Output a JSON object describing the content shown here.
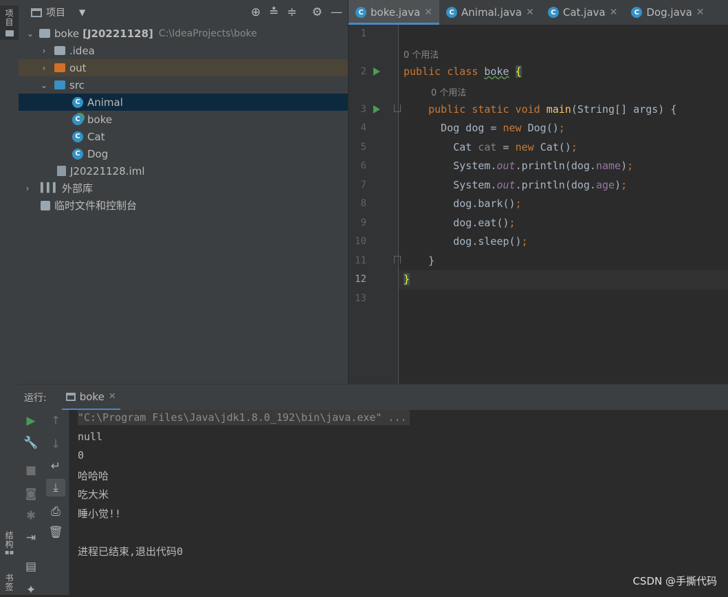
{
  "left_strip": {
    "project_tab": "项目",
    "structure_tab": "结构",
    "bookmarks_tab": "书签"
  },
  "project": {
    "title": "项目",
    "tree": [
      {
        "label": "boke",
        "bold_suffix": "[J20221128]",
        "hint": "C:\\IdeaProjects\\boke",
        "level": 0,
        "expanded": true,
        "icon": "module-folder-icon"
      },
      {
        "label": ".idea",
        "level": 1,
        "expanded": false,
        "icon": "folder-icon"
      },
      {
        "label": "out",
        "level": 1,
        "expanded": false,
        "icon": "orange-folder-icon",
        "highlight": true
      },
      {
        "label": "src",
        "level": 1,
        "expanded": true,
        "icon": "source-folder-icon"
      },
      {
        "label": "Animal",
        "level": 2,
        "icon": "class-icon",
        "selected": true
      },
      {
        "label": "boke",
        "level": 2,
        "icon": "runnable-class-icon"
      },
      {
        "label": "Cat",
        "level": 2,
        "icon": "class-icon"
      },
      {
        "label": "Dog",
        "level": 2,
        "icon": "class-icon"
      },
      {
        "label": "J20221128.iml",
        "level": 1,
        "icon": "iml-file-icon"
      },
      {
        "label": "外部库",
        "level": 0,
        "expanded": false,
        "icon": "library-icon"
      },
      {
        "label": "临时文件和控制台",
        "level": 0,
        "icon": "scratch-icon"
      }
    ]
  },
  "editor": {
    "tabs": [
      {
        "label": "boke.java",
        "active": true
      },
      {
        "label": "Animal.java"
      },
      {
        "label": "Cat.java"
      },
      {
        "label": "Dog.java"
      }
    ],
    "usage_hint": "0 个用法",
    "line_numbers": [
      "1",
      "2",
      "3",
      "4",
      "5",
      "6",
      "7",
      "8",
      "9",
      "10",
      "11",
      "12",
      "13"
    ],
    "current_line": "12"
  },
  "run": {
    "label": "运行:",
    "tab": "boke",
    "output": [
      "\"C:\\Program Files\\Java\\jdk1.8.0_192\\bin\\java.exe\" ...",
      "null",
      "0",
      "哈哈哈",
      "吃大米",
      "睡小觉!!",
      "",
      "进程已结束,退出代码0"
    ]
  },
  "watermark": "CSDN @手撕代码",
  "colors": {
    "accent": "#4a88c7",
    "keyword": "#cc7832",
    "method": "#ffc66d",
    "field": "#9876aa",
    "run_green": "#499c54"
  }
}
